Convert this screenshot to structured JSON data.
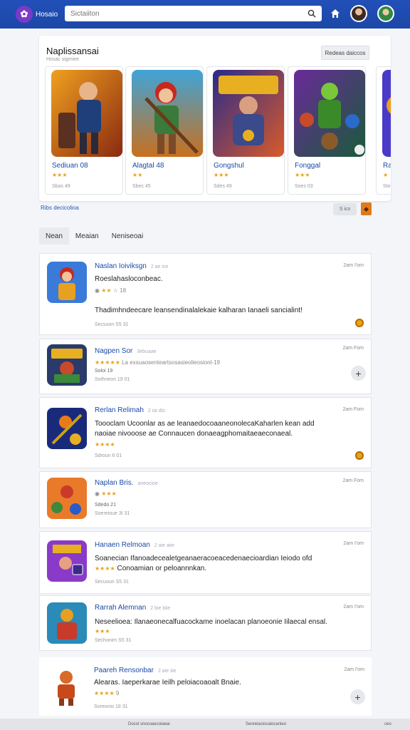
{
  "header": {
    "brand": "Hosaio",
    "search_placeholder": "Sictaiiton",
    "icons": [
      "logo-icon",
      "search-icon",
      "home-icon",
      "user-avatar",
      "user-avatar"
    ]
  },
  "featured": {
    "title": "Naplissansai",
    "subtitle": "Hosac sigmiee",
    "button": "Redeas daiccos",
    "games": [
      {
        "name": "Sediuan 08",
        "stars": "★★★",
        "meta": "Sbas 49"
      },
      {
        "name": "Alagtal 48",
        "stars": "★★",
        "meta": "Sbec 45"
      },
      {
        "name": "Gongshul",
        "stars": "★★★",
        "meta": "Sdes 49"
      },
      {
        "name": "Fonggal",
        "stars": "★★★",
        "meta": "Soes 03"
      },
      {
        "name": "Ran",
        "stars": "★",
        "meta": "Sto"
      }
    ]
  },
  "filter_link": "Ribs decicolioa",
  "pill_label": "S ico",
  "tabs": [
    "Nean",
    "Meaian",
    "Neniseoai"
  ],
  "reviews": [
    {
      "title": "Naslan Ioiviksgn",
      "dim": "2 ae ice",
      "date": "2am I'om",
      "line1": "Roeslahasloconbeac.",
      "stars": "★★",
      "stars_extra": "18",
      "line2": "Thadimhndeecare leansendinalalekaie kalharan Ianaeli sancialint!",
      "meta": "Secsuon S5 31"
    },
    {
      "title": "Nagpen Sor",
      "dim": "3ebuaae",
      "date": "2am Fom",
      "stars": "★★★★★",
      "stars_extra": "La exsuaosenteartsosasieolieosionl-19",
      "small": "Soloi 19",
      "meta": "Sothneon 19 01"
    },
    {
      "title": "Rerlan Relimah",
      "dim": "2 iai dio",
      "date": "2am Fom",
      "line1": "Toooclam Ucoonlar as ae leanaedocoaaneonolecaKaharlen kean add",
      "line2": "naoiae nivooose ae Connaucen donaeagphomaitaeaeconaeal.",
      "stars": "★★★★",
      "meta": "Sdroun 6 01"
    },
    {
      "title": "Naplan Bris.",
      "dim": "aneocioe",
      "date": "2am Fom",
      "stars": "★★★",
      "small": "Sdedo 21",
      "meta": "Soereioue 3I 31"
    },
    {
      "title": "Hanaen Relmoan",
      "dim": "2 aie aiie",
      "date": "2am I'om",
      "line1": "Soanecian Ifanoadecealetgeanaeracoeacedenaecioardian Ieiodo ofd",
      "stars": "★★★★",
      "stars_extra": "Conoamian or peloannnkan.",
      "meta": "Secuoun S5 31"
    },
    {
      "title": "Rarrah Alemnan",
      "dim": "2 bie biie",
      "date": "2am I'om",
      "line1": "Neseelioea: Ilanaeonecalfuacockame inoelacan planoeonie Iilaecal ensal.",
      "stars": "★★★",
      "meta": "Sechonim S5 31"
    },
    {
      "title": "Paareh Rensonbar",
      "dim": "2 aie iiie",
      "date": "2am I'om",
      "line1": "Alearas. Iaeperkarae Ieilh peloiacoaoalt Bnaie.",
      "stars": "★★★★",
      "stars_extra": "9",
      "meta": "Soreonio 18 31"
    }
  ],
  "footer": [
    "Docol snocoaecoiaeai",
    "Seoreiaciocaiocanieo",
    "ceo"
  ],
  "colors": {
    "topbar": "#2250b8",
    "accent": "#1a4aa8",
    "star": "#e8a21a"
  }
}
